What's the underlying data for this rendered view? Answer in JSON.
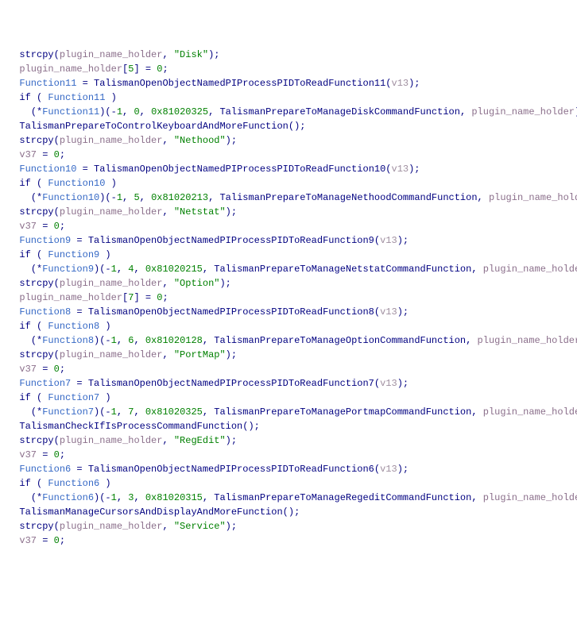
{
  "lines": [
    {
      "indent": 1,
      "parts": [
        {
          "cls": "kw",
          "t": "strcpy"
        },
        {
          "cls": "op",
          "t": "("
        },
        {
          "cls": "param",
          "t": "plugin_name_holder"
        },
        {
          "cls": "op",
          "t": ", "
        },
        {
          "cls": "str",
          "t": "\"Disk\""
        },
        {
          "cls": "op",
          "t": ");"
        }
      ]
    },
    {
      "indent": 1,
      "parts": [
        {
          "cls": "param",
          "t": "plugin_name_holder"
        },
        {
          "cls": "op",
          "t": "["
        },
        {
          "cls": "num",
          "t": "5"
        },
        {
          "cls": "op",
          "t": "] = "
        },
        {
          "cls": "num",
          "t": "0"
        },
        {
          "cls": "op",
          "t": ";"
        }
      ]
    },
    {
      "indent": 1,
      "parts": [
        {
          "cls": "func",
          "t": "Function11"
        },
        {
          "cls": "op",
          "t": " = "
        },
        {
          "cls": "kw",
          "t": "TalismanOpenObjectNamedPIProcessPIDToReadFunction11"
        },
        {
          "cls": "op",
          "t": "("
        },
        {
          "cls": "v",
          "t": "v13"
        },
        {
          "cls": "op",
          "t": ");"
        }
      ]
    },
    {
      "indent": 1,
      "parts": [
        {
          "cls": "kw",
          "t": "if"
        },
        {
          "cls": "op",
          "t": " ( "
        },
        {
          "cls": "func",
          "t": "Function11"
        },
        {
          "cls": "op",
          "t": " )"
        }
      ]
    },
    {
      "indent": 2,
      "parts": [
        {
          "cls": "op",
          "t": "(*"
        },
        {
          "cls": "func",
          "t": "Function11"
        },
        {
          "cls": "op",
          "t": ")(-"
        },
        {
          "cls": "num",
          "t": "1"
        },
        {
          "cls": "op",
          "t": ", "
        },
        {
          "cls": "num",
          "t": "0"
        },
        {
          "cls": "op",
          "t": ", "
        },
        {
          "cls": "num",
          "t": "0x81020325"
        },
        {
          "cls": "op",
          "t": ", "
        },
        {
          "cls": "kw",
          "t": "TalismanPrepareToManageDiskCommandFunction"
        },
        {
          "cls": "op",
          "t": ", "
        },
        {
          "cls": "param",
          "t": "plugin_name_holder"
        },
        {
          "cls": "op",
          "t": ");"
        }
      ]
    },
    {
      "indent": 1,
      "parts": [
        {
          "cls": "kw",
          "t": "TalismanPrepareToControlKeyboardAndMoreFunction"
        },
        {
          "cls": "op",
          "t": "();"
        }
      ]
    },
    {
      "indent": 1,
      "parts": [
        {
          "cls": "kw",
          "t": "strcpy"
        },
        {
          "cls": "op",
          "t": "("
        },
        {
          "cls": "param",
          "t": "plugin_name_holder"
        },
        {
          "cls": "op",
          "t": ", "
        },
        {
          "cls": "str",
          "t": "\"Nethood\""
        },
        {
          "cls": "op",
          "t": ");"
        }
      ]
    },
    {
      "indent": 1,
      "parts": [
        {
          "cls": "var",
          "t": "v37"
        },
        {
          "cls": "op",
          "t": " = "
        },
        {
          "cls": "num",
          "t": "0"
        },
        {
          "cls": "op",
          "t": ";"
        }
      ]
    },
    {
      "indent": 1,
      "parts": [
        {
          "cls": "func",
          "t": "Function10"
        },
        {
          "cls": "op",
          "t": " = "
        },
        {
          "cls": "kw",
          "t": "TalismanOpenObjectNamedPIProcessPIDToReadFunction10"
        },
        {
          "cls": "op",
          "t": "("
        },
        {
          "cls": "v",
          "t": "v13"
        },
        {
          "cls": "op",
          "t": ");"
        }
      ]
    },
    {
      "indent": 1,
      "parts": [
        {
          "cls": "kw",
          "t": "if"
        },
        {
          "cls": "op",
          "t": " ( "
        },
        {
          "cls": "func",
          "t": "Function10"
        },
        {
          "cls": "op",
          "t": " )"
        }
      ]
    },
    {
      "indent": 2,
      "parts": [
        {
          "cls": "op",
          "t": "(*"
        },
        {
          "cls": "func",
          "t": "Function10"
        },
        {
          "cls": "op",
          "t": ")(-"
        },
        {
          "cls": "num",
          "t": "1"
        },
        {
          "cls": "op",
          "t": ", "
        },
        {
          "cls": "num",
          "t": "5"
        },
        {
          "cls": "op",
          "t": ", "
        },
        {
          "cls": "num",
          "t": "0x81020213"
        },
        {
          "cls": "op",
          "t": ", "
        },
        {
          "cls": "kw",
          "t": "TalismanPrepareToManageNethoodCommandFunction"
        },
        {
          "cls": "op",
          "t": ", "
        },
        {
          "cls": "param",
          "t": "plugin_name_holder"
        },
        {
          "cls": "op",
          "t": ");"
        }
      ]
    },
    {
      "indent": 1,
      "parts": [
        {
          "cls": "kw",
          "t": "strcpy"
        },
        {
          "cls": "op",
          "t": "("
        },
        {
          "cls": "param",
          "t": "plugin_name_holder"
        },
        {
          "cls": "op",
          "t": ", "
        },
        {
          "cls": "str",
          "t": "\"Netstat\""
        },
        {
          "cls": "op",
          "t": ");"
        }
      ]
    },
    {
      "indent": 1,
      "parts": [
        {
          "cls": "var",
          "t": "v37"
        },
        {
          "cls": "op",
          "t": " = "
        },
        {
          "cls": "num",
          "t": "0"
        },
        {
          "cls": "op",
          "t": ";"
        }
      ]
    },
    {
      "indent": 1,
      "parts": [
        {
          "cls": "func",
          "t": "Function9"
        },
        {
          "cls": "op",
          "t": " = "
        },
        {
          "cls": "kw",
          "t": "TalismanOpenObjectNamedPIProcessPIDToReadFunction9"
        },
        {
          "cls": "op",
          "t": "("
        },
        {
          "cls": "v",
          "t": "v13"
        },
        {
          "cls": "op",
          "t": ");"
        }
      ]
    },
    {
      "indent": 1,
      "parts": [
        {
          "cls": "kw",
          "t": "if"
        },
        {
          "cls": "op",
          "t": " ( "
        },
        {
          "cls": "func",
          "t": "Function9"
        },
        {
          "cls": "op",
          "t": " )"
        }
      ]
    },
    {
      "indent": 2,
      "parts": [
        {
          "cls": "op",
          "t": "(*"
        },
        {
          "cls": "func",
          "t": "Function9"
        },
        {
          "cls": "op",
          "t": ")(-"
        },
        {
          "cls": "num",
          "t": "1"
        },
        {
          "cls": "op",
          "t": ", "
        },
        {
          "cls": "num",
          "t": "4"
        },
        {
          "cls": "op",
          "t": ", "
        },
        {
          "cls": "num",
          "t": "0x81020215"
        },
        {
          "cls": "op",
          "t": ", "
        },
        {
          "cls": "kw",
          "t": "TalismanPrepareToManageNetstatCommandFunction"
        },
        {
          "cls": "op",
          "t": ", "
        },
        {
          "cls": "param",
          "t": "plugin_name_holder"
        },
        {
          "cls": "op",
          "t": ");"
        }
      ]
    },
    {
      "indent": 1,
      "parts": [
        {
          "cls": "kw",
          "t": "strcpy"
        },
        {
          "cls": "op",
          "t": "("
        },
        {
          "cls": "param",
          "t": "plugin_name_holder"
        },
        {
          "cls": "op",
          "t": ", "
        },
        {
          "cls": "str",
          "t": "\"Option\""
        },
        {
          "cls": "op",
          "t": ");"
        }
      ]
    },
    {
      "indent": 1,
      "parts": [
        {
          "cls": "param",
          "t": "plugin_name_holder"
        },
        {
          "cls": "op",
          "t": "["
        },
        {
          "cls": "num",
          "t": "7"
        },
        {
          "cls": "op",
          "t": "] = "
        },
        {
          "cls": "num",
          "t": "0"
        },
        {
          "cls": "op",
          "t": ";"
        }
      ]
    },
    {
      "indent": 1,
      "parts": [
        {
          "cls": "func",
          "t": "Function8"
        },
        {
          "cls": "op",
          "t": " = "
        },
        {
          "cls": "kw",
          "t": "TalismanOpenObjectNamedPIProcessPIDToReadFunction8"
        },
        {
          "cls": "op",
          "t": "("
        },
        {
          "cls": "v",
          "t": "v13"
        },
        {
          "cls": "op",
          "t": ");"
        }
      ]
    },
    {
      "indent": 1,
      "parts": [
        {
          "cls": "kw",
          "t": "if"
        },
        {
          "cls": "op",
          "t": " ( "
        },
        {
          "cls": "func",
          "t": "Function8"
        },
        {
          "cls": "op",
          "t": " )"
        }
      ]
    },
    {
      "indent": 2,
      "parts": [
        {
          "cls": "op",
          "t": "(*"
        },
        {
          "cls": "func",
          "t": "Function8"
        },
        {
          "cls": "op",
          "t": ")(-"
        },
        {
          "cls": "num",
          "t": "1"
        },
        {
          "cls": "op",
          "t": ", "
        },
        {
          "cls": "num",
          "t": "6"
        },
        {
          "cls": "op",
          "t": ", "
        },
        {
          "cls": "num",
          "t": "0x81020128"
        },
        {
          "cls": "op",
          "t": ", "
        },
        {
          "cls": "kw",
          "t": "TalismanPrepareToManageOptionCommandFunction"
        },
        {
          "cls": "op",
          "t": ", "
        },
        {
          "cls": "param",
          "t": "plugin_name_holder"
        },
        {
          "cls": "op",
          "t": ");"
        }
      ]
    },
    {
      "indent": 1,
      "parts": [
        {
          "cls": "kw",
          "t": "strcpy"
        },
        {
          "cls": "op",
          "t": "("
        },
        {
          "cls": "param",
          "t": "plugin_name_holder"
        },
        {
          "cls": "op",
          "t": ", "
        },
        {
          "cls": "str",
          "t": "\"PortMap\""
        },
        {
          "cls": "op",
          "t": ");"
        }
      ]
    },
    {
      "indent": 1,
      "parts": [
        {
          "cls": "var",
          "t": "v37"
        },
        {
          "cls": "op",
          "t": " = "
        },
        {
          "cls": "num",
          "t": "0"
        },
        {
          "cls": "op",
          "t": ";"
        }
      ]
    },
    {
      "indent": 1,
      "parts": [
        {
          "cls": "func",
          "t": "Function7"
        },
        {
          "cls": "op",
          "t": " = "
        },
        {
          "cls": "kw",
          "t": "TalismanOpenObjectNamedPIProcessPIDToReadFunction7"
        },
        {
          "cls": "op",
          "t": "("
        },
        {
          "cls": "v",
          "t": "v13"
        },
        {
          "cls": "op",
          "t": ");"
        }
      ]
    },
    {
      "indent": 1,
      "parts": [
        {
          "cls": "kw",
          "t": "if"
        },
        {
          "cls": "op",
          "t": " ( "
        },
        {
          "cls": "func",
          "t": "Function7"
        },
        {
          "cls": "op",
          "t": " )"
        }
      ]
    },
    {
      "indent": 2,
      "parts": [
        {
          "cls": "op",
          "t": "(*"
        },
        {
          "cls": "func",
          "t": "Function7"
        },
        {
          "cls": "op",
          "t": ")(-"
        },
        {
          "cls": "num",
          "t": "1"
        },
        {
          "cls": "op",
          "t": ", "
        },
        {
          "cls": "num",
          "t": "7"
        },
        {
          "cls": "op",
          "t": ", "
        },
        {
          "cls": "num",
          "t": "0x81020325"
        },
        {
          "cls": "op",
          "t": ", "
        },
        {
          "cls": "kw",
          "t": "TalismanPrepareToManagePortmapCommandFunction"
        },
        {
          "cls": "op",
          "t": ", "
        },
        {
          "cls": "param",
          "t": "plugin_name_holder"
        },
        {
          "cls": "op",
          "t": ");"
        }
      ]
    },
    {
      "indent": 1,
      "parts": [
        {
          "cls": "kw",
          "t": "TalismanCheckIfIsProcessCommandFunction"
        },
        {
          "cls": "op",
          "t": "();"
        }
      ]
    },
    {
      "indent": 1,
      "parts": [
        {
          "cls": "kw",
          "t": "strcpy"
        },
        {
          "cls": "op",
          "t": "("
        },
        {
          "cls": "param",
          "t": "plugin_name_holder"
        },
        {
          "cls": "op",
          "t": ", "
        },
        {
          "cls": "str",
          "t": "\"RegEdit\""
        },
        {
          "cls": "op",
          "t": ");"
        }
      ]
    },
    {
      "indent": 1,
      "parts": [
        {
          "cls": "var",
          "t": "v37"
        },
        {
          "cls": "op",
          "t": " = "
        },
        {
          "cls": "num",
          "t": "0"
        },
        {
          "cls": "op",
          "t": ";"
        }
      ]
    },
    {
      "indent": 1,
      "parts": [
        {
          "cls": "func",
          "t": "Function6"
        },
        {
          "cls": "op",
          "t": " = "
        },
        {
          "cls": "kw",
          "t": "TalismanOpenObjectNamedPIProcessPIDToReadFunction6"
        },
        {
          "cls": "op",
          "t": "("
        },
        {
          "cls": "v",
          "t": "v13"
        },
        {
          "cls": "op",
          "t": ");"
        }
      ]
    },
    {
      "indent": 1,
      "parts": [
        {
          "cls": "kw",
          "t": "if"
        },
        {
          "cls": "op",
          "t": " ( "
        },
        {
          "cls": "func",
          "t": "Function6"
        },
        {
          "cls": "op",
          "t": " )"
        }
      ]
    },
    {
      "indent": 2,
      "parts": [
        {
          "cls": "op",
          "t": "(*"
        },
        {
          "cls": "func",
          "t": "Function6"
        },
        {
          "cls": "op",
          "t": ")(-"
        },
        {
          "cls": "num",
          "t": "1"
        },
        {
          "cls": "op",
          "t": ", "
        },
        {
          "cls": "num",
          "t": "3"
        },
        {
          "cls": "op",
          "t": ", "
        },
        {
          "cls": "num",
          "t": "0x81020315"
        },
        {
          "cls": "op",
          "t": ", "
        },
        {
          "cls": "kw",
          "t": "TalismanPrepareToManageRegeditCommandFunction"
        },
        {
          "cls": "op",
          "t": ", "
        },
        {
          "cls": "param",
          "t": "plugin_name_holder"
        },
        {
          "cls": "op",
          "t": ");"
        }
      ]
    },
    {
      "indent": 1,
      "parts": [
        {
          "cls": "kw",
          "t": "TalismanManageCursorsAndDisplayAndMoreFunction"
        },
        {
          "cls": "op",
          "t": "();"
        }
      ]
    },
    {
      "indent": 1,
      "parts": [
        {
          "cls": "kw",
          "t": "strcpy"
        },
        {
          "cls": "op",
          "t": "("
        },
        {
          "cls": "param",
          "t": "plugin_name_holder"
        },
        {
          "cls": "op",
          "t": ", "
        },
        {
          "cls": "str",
          "t": "\"Service\""
        },
        {
          "cls": "op",
          "t": ");"
        }
      ]
    },
    {
      "indent": 1,
      "parts": [
        {
          "cls": "var",
          "t": "v37"
        },
        {
          "cls": "op",
          "t": " = "
        },
        {
          "cls": "num",
          "t": "0"
        },
        {
          "cls": "op",
          "t": ";"
        }
      ]
    }
  ]
}
